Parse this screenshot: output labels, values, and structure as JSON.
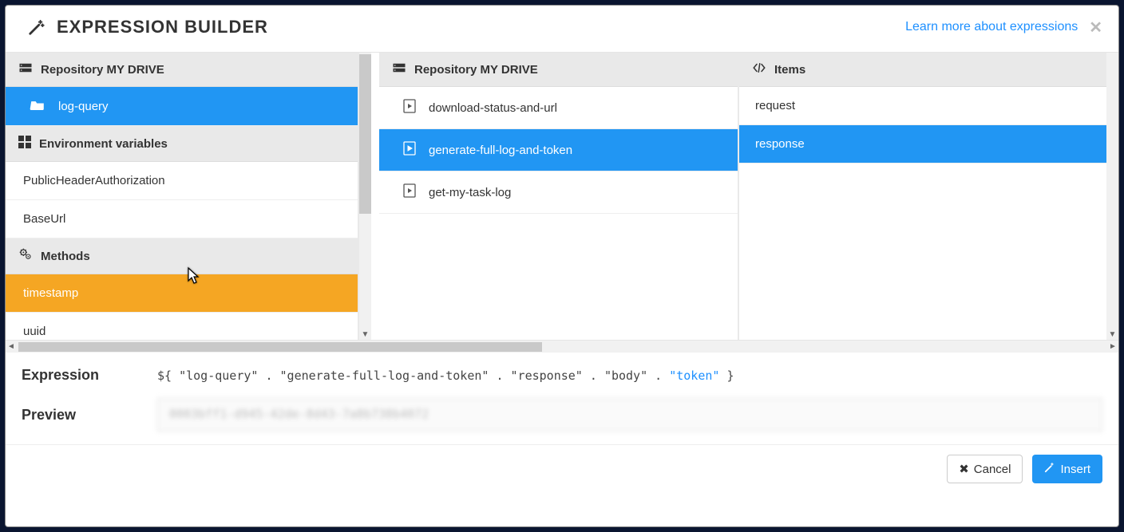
{
  "header": {
    "title": "EXPRESSION BUILDER",
    "learn_more": "Learn more about expressions"
  },
  "left_col": {
    "section1_title": "Repository MY DRIVE",
    "item1": "log-query",
    "section2_title": "Environment variables",
    "env1": "PublicHeaderAuthorization",
    "env2": "BaseUrl",
    "section3_title": "Methods",
    "m1": "timestamp",
    "m2": "uuid"
  },
  "mid_col": {
    "header": "Repository MY DRIVE",
    "item1": "download-status-and-url",
    "item2": "generate-full-log-and-token",
    "item3": "get-my-task-log"
  },
  "right_col": {
    "header": "Items",
    "item1": "request",
    "item2": "response"
  },
  "expression": {
    "label": "Expression",
    "prefix": "${ ",
    "p1": "\"log-query\"",
    "d1": " . ",
    "p2": "\"generate-full-log-and-token\"",
    "d2": " . ",
    "p3": "\"response\"",
    "d3": " . ",
    "p4": "\"body\"",
    "d4": " . ",
    "p5": "\"token\"",
    "suffix": " }"
  },
  "preview": {
    "label": "Preview",
    "value": "0003bff1-d945-42de-8d43-7a8b738b4072"
  },
  "footer": {
    "cancel": "Cancel",
    "insert": "Insert"
  }
}
